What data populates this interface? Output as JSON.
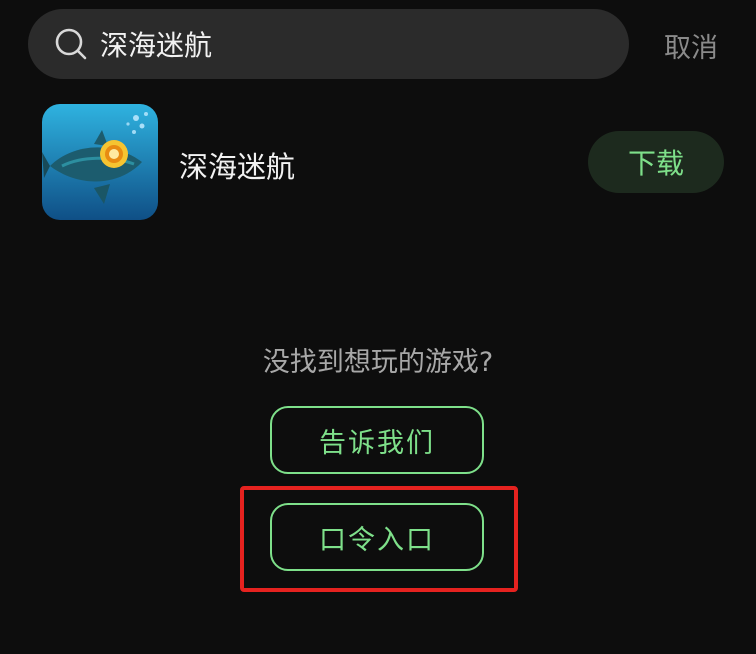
{
  "search": {
    "value": "深海迷航",
    "cancel_label": "取消"
  },
  "result": {
    "app_name": "深海迷航",
    "download_label": "下载"
  },
  "empty_hint": {
    "text": "没找到想玩的游戏?",
    "tell_us_label": "告诉我们",
    "code_entry_label": "口令入口"
  },
  "colors": {
    "background": "#0d0d0d",
    "accent_green": "#7ee08a",
    "highlight_red": "#e5221f",
    "search_bg": "#2b2b2b"
  }
}
